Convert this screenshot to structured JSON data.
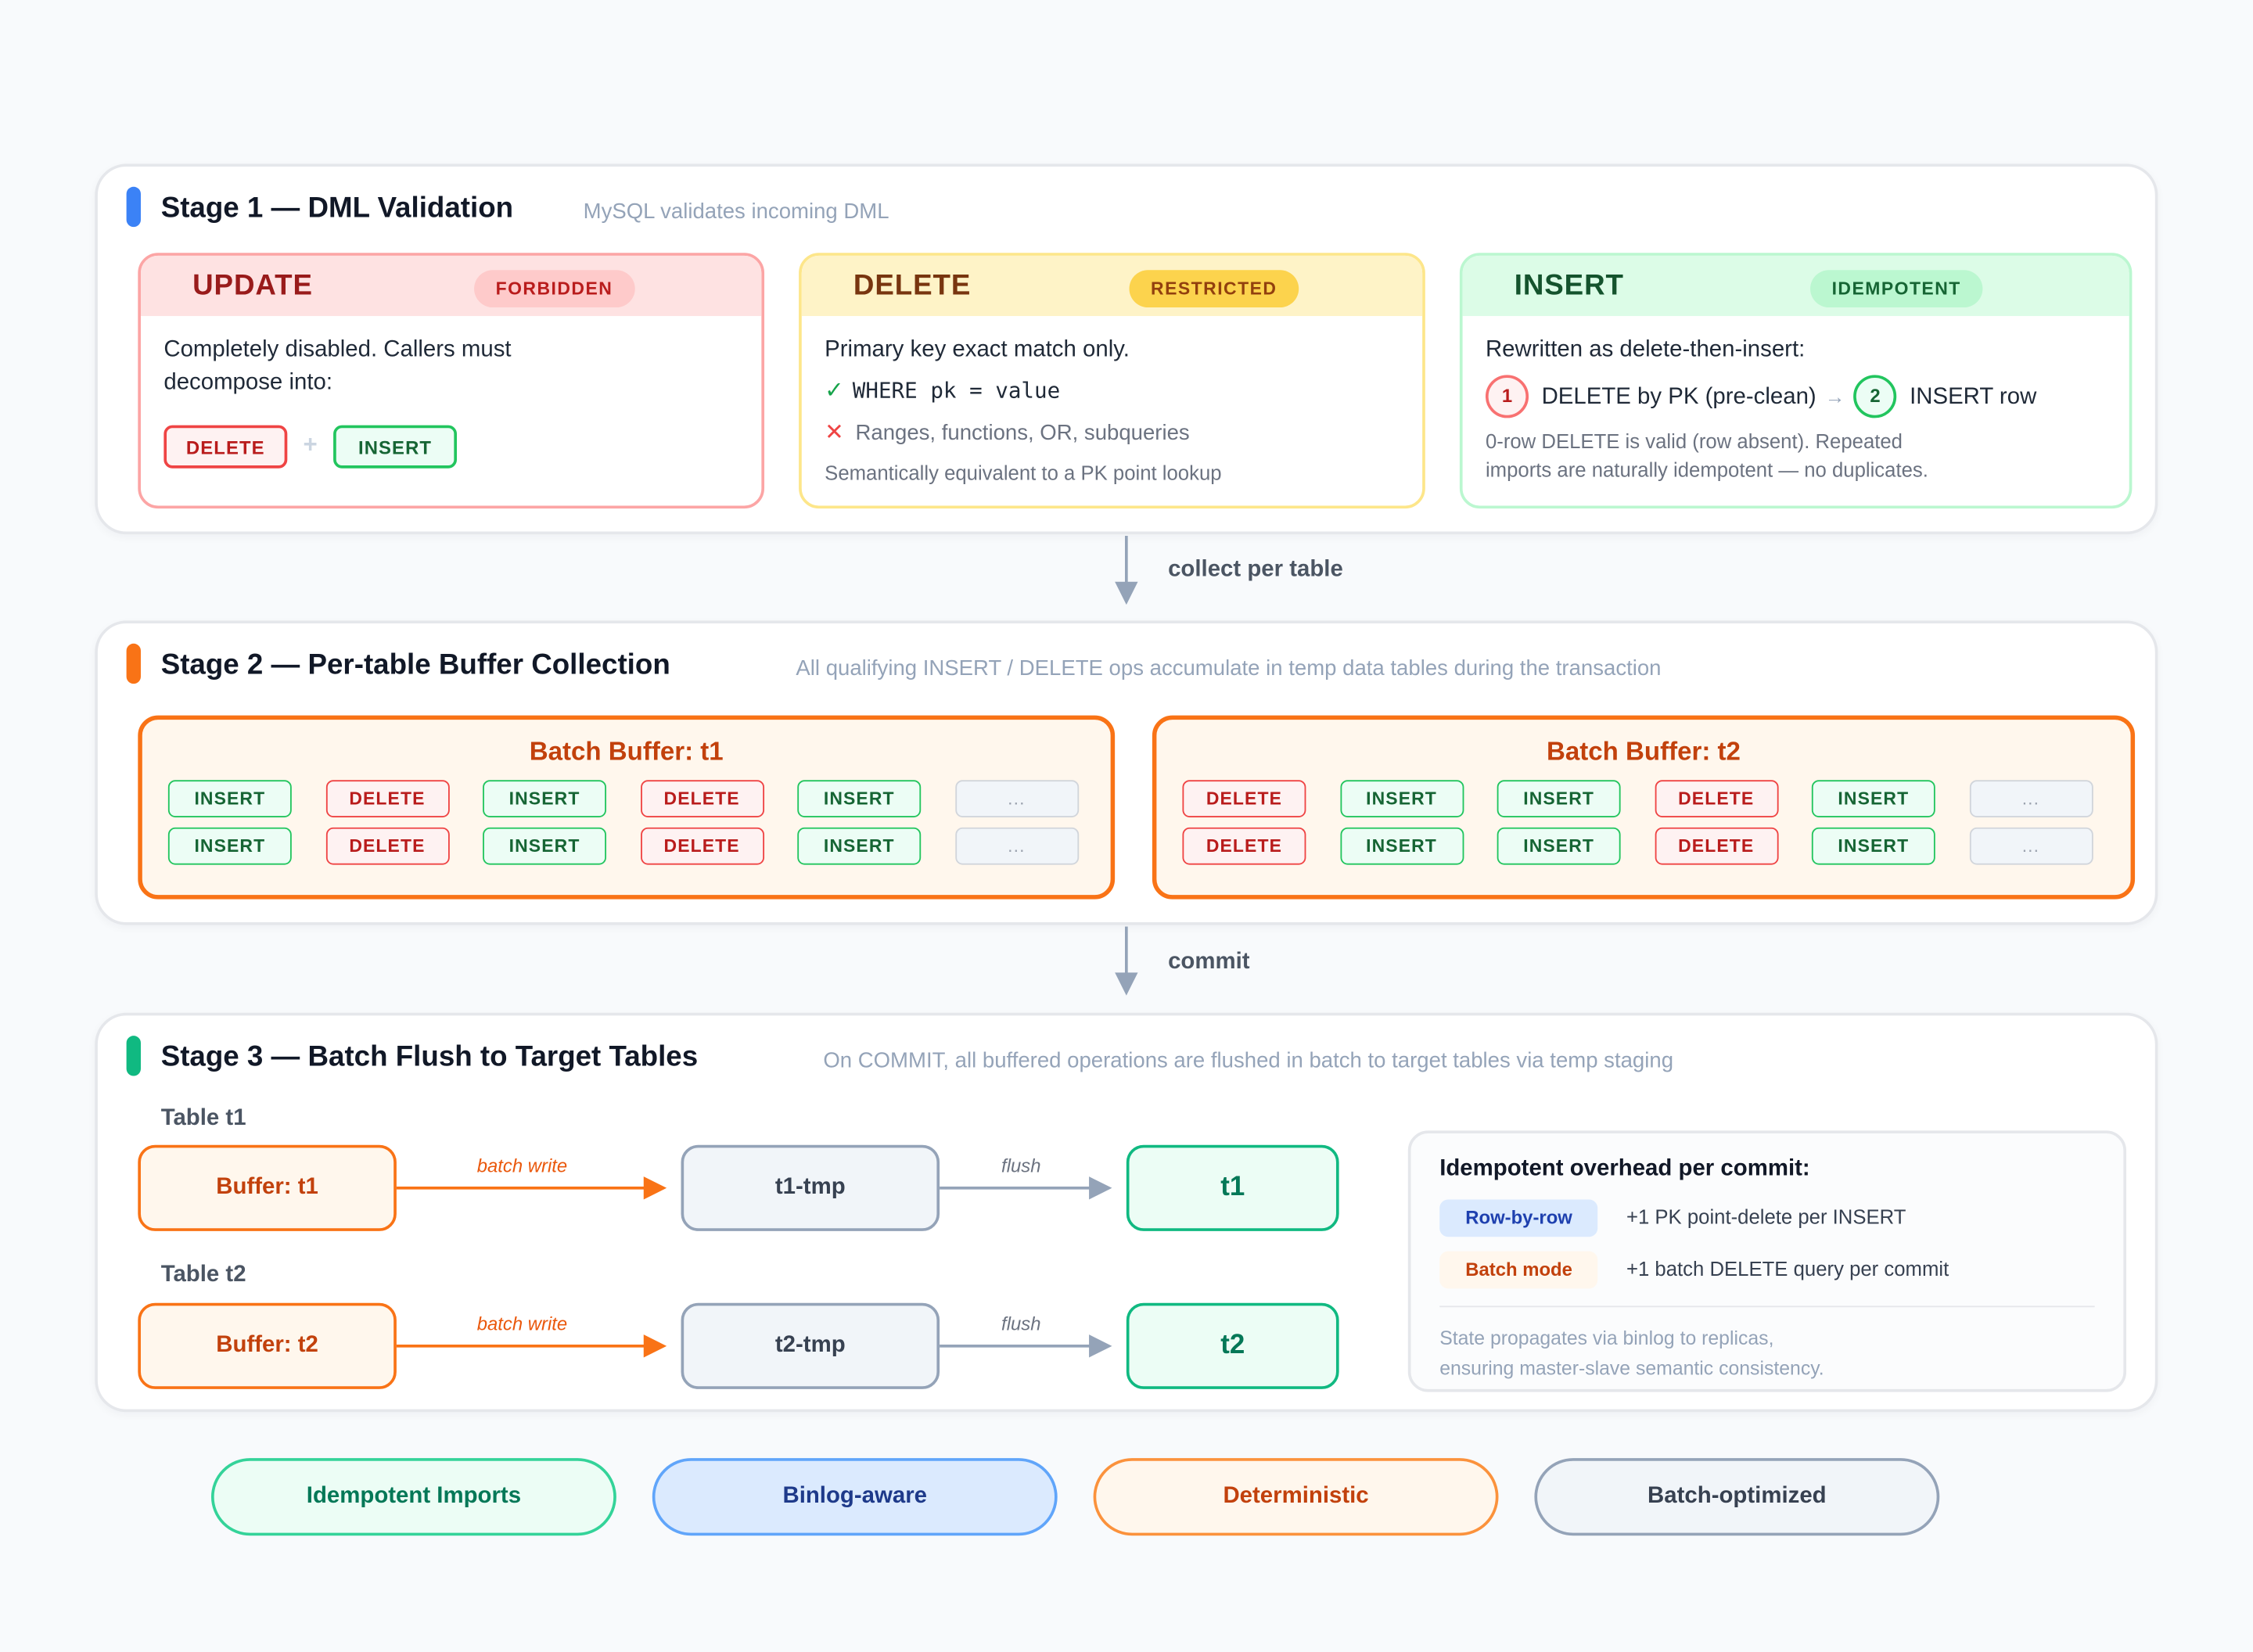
{
  "stage1": {
    "title": "Stage 1 — DML Validation",
    "subtitle": "MySQL validates incoming DML",
    "update": {
      "name": "UPDATE",
      "badge": "FORBIDDEN",
      "desc_line1": "Completely disabled. Callers must",
      "desc_line2": "decompose into:",
      "tag_delete": "DELETE",
      "plus": "+",
      "tag_insert": "INSERT"
    },
    "delete": {
      "name": "DELETE",
      "badge": "RESTRICTED",
      "desc": "Primary key exact match only.",
      "check_icon": "✓",
      "allowed": "WHERE pk = value",
      "cross_icon": "✕",
      "disallowed": "Ranges, functions, OR, subqueries",
      "note": "Semantically equivalent to a PK point lookup"
    },
    "insert": {
      "name": "INSERT",
      "badge": "IDEMPOTENT",
      "desc": "Rewritten as delete-then-insert:",
      "step1_num": "1",
      "step1": "DELETE by PK (pre-clean)",
      "step_arrow": "→",
      "step2_num": "2",
      "step2": "INSERT row",
      "note_line1": "0-row DELETE is valid (row absent). Repeated",
      "note_line2": "imports are naturally idempotent — no duplicates."
    }
  },
  "connector1": "collect per table",
  "stage2": {
    "title": "Stage 2 — Per-table Buffer Collection",
    "subtitle": "All qualifying INSERT / DELETE ops accumulate in temp data tables during the transaction",
    "buffers": [
      {
        "title": "Batch Buffer: t1",
        "rows": [
          [
            "INSERT",
            "DELETE",
            "INSERT",
            "DELETE",
            "INSERT",
            "..."
          ],
          [
            "INSERT",
            "DELETE",
            "INSERT",
            "DELETE",
            "INSERT",
            "..."
          ]
        ]
      },
      {
        "title": "Batch Buffer: t2",
        "rows": [
          [
            "DELETE",
            "INSERT",
            "INSERT",
            "DELETE",
            "INSERT",
            "..."
          ],
          [
            "DELETE",
            "INSERT",
            "INSERT",
            "DELETE",
            "INSERT",
            "..."
          ]
        ]
      }
    ]
  },
  "connector2": "commit",
  "stage3": {
    "title": "Stage 3 — Batch Flush to Target Tables",
    "subtitle": "On COMMIT, all buffered operations are flushed in batch to target tables via temp staging",
    "flows": [
      {
        "label": "Table t1",
        "buffer": "Buffer: t1",
        "write_label": "batch write",
        "tmp": "t1-tmp",
        "flush_label": "flush",
        "target": "t1"
      },
      {
        "label": "Table t2",
        "buffer": "Buffer: t2",
        "write_label": "batch write",
        "tmp": "t2-tmp",
        "flush_label": "flush",
        "target": "t2"
      }
    ],
    "overhead": {
      "title": "Idempotent overhead per commit:",
      "row_tag": "Row-by-row",
      "row_text": "+1 PK point-delete per INSERT",
      "batch_tag": "Batch mode",
      "batch_text": "+1 batch DELETE query per commit",
      "note_line1": "State propagates via binlog to replicas,",
      "note_line2": "ensuring master-slave semantic consistency."
    }
  },
  "pills": [
    "Idempotent Imports",
    "Binlog-aware",
    "Deterministic",
    "Batch-optimized"
  ],
  "colors": {
    "stage1": "#3b82f6",
    "stage2": "#f97316",
    "stage3": "#10b981",
    "forbidden": "#ef4444",
    "restricted": "#eab308",
    "idempotent": "#22c55e"
  }
}
